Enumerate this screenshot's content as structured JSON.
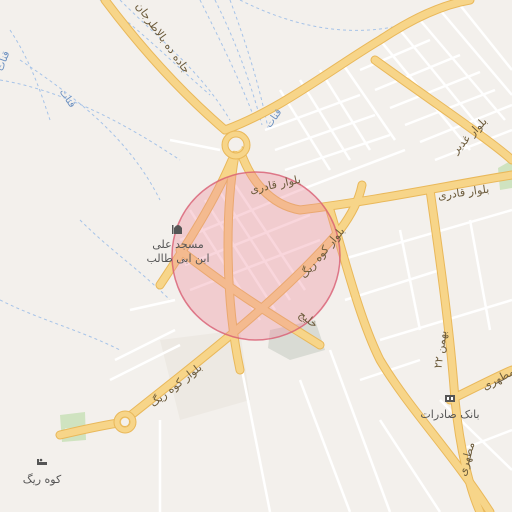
{
  "map": {
    "roads": {
      "jadeh_dehbala": "جاده ده بالاطرجان",
      "bolvar_ghaderi_1": "بلوار قادری",
      "bolvar_ghaderi_2": "بلوار قادری",
      "bolvar_kuh_rig_1": "بلوار کوه ریگ",
      "bolvar_kuh_rig_2": "بلوار کوه ریگ",
      "bolvar_ghadir": "بلوار غدیر",
      "bahman_22": "۲۲ بهمن",
      "motahari_1": "مطهری",
      "motahari_2": "مطهری",
      "khalij": "خلیج",
      "qanat_1": "قنات",
      "qanat_2": "قنات",
      "qanat_3": "قنات"
    },
    "pois": {
      "mosque_line1": "مسجد علی",
      "mosque_line2": "ابن ابی طالب",
      "bank": "بانک صادرات",
      "hotel": "کوه ریگ"
    },
    "colors": {
      "background": "#f3f0ec",
      "major_road": "#f7d589",
      "major_road_casing": "#e9b85a",
      "minor_road": "#ffffff",
      "water": "#a6c3e8",
      "green": "#cfe3c0",
      "highlight_fill": "#ee8a9a",
      "highlight_stroke": "#d85d72"
    },
    "icons": {
      "mosque": "mosque-icon",
      "bank": "bank-icon",
      "hotel": "hotel-icon"
    }
  }
}
